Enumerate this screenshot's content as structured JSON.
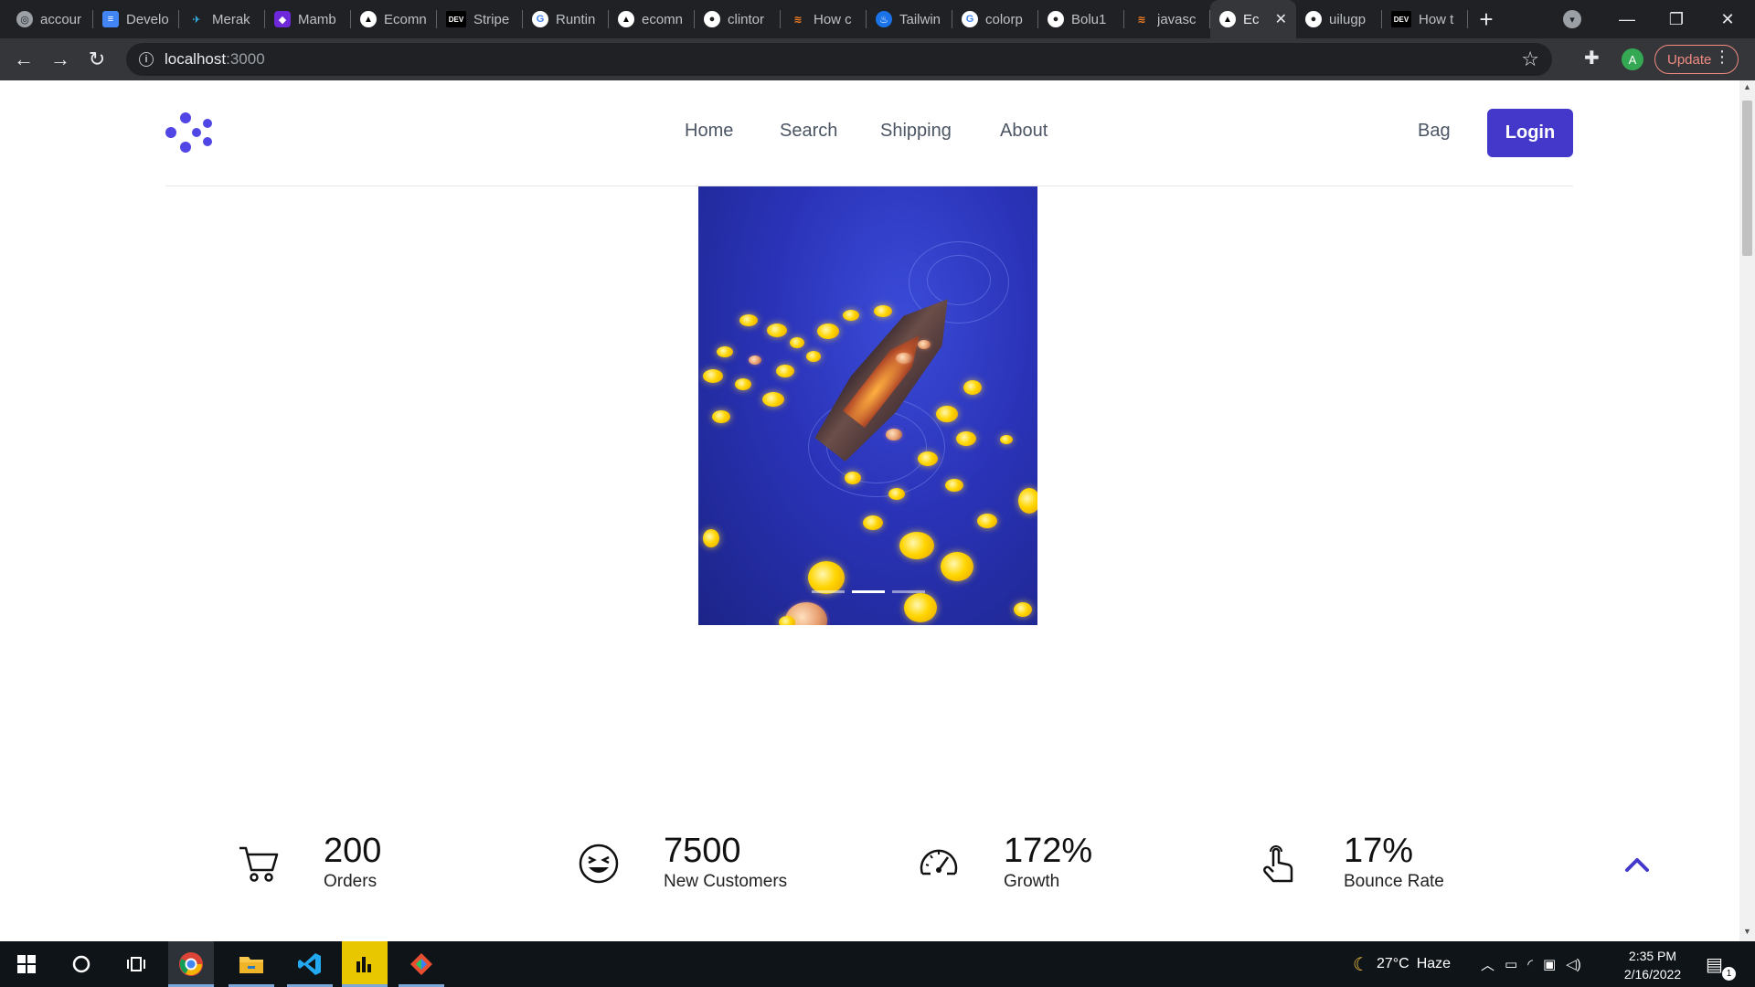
{
  "browser": {
    "tabs": [
      {
        "favicon": "globe-icon",
        "glyph": "◎",
        "title": "accour"
      },
      {
        "favicon": "docs-icon",
        "glyph": "≡",
        "title": "Develo"
      },
      {
        "favicon": "bird-icon",
        "glyph": "✈",
        "title": "Merak"
      },
      {
        "favicon": "mamba-icon",
        "glyph": "◆",
        "title": "Mamb"
      },
      {
        "favicon": "vercel-icon",
        "glyph": "▲",
        "title": "Ecomn"
      },
      {
        "favicon": "dev-icon",
        "glyph": "DEV",
        "title": "Stripe"
      },
      {
        "favicon": "google-icon",
        "glyph": "G",
        "title": "Runtin"
      },
      {
        "favicon": "vercel-icon",
        "glyph": "▲",
        "title": "ecomn"
      },
      {
        "favicon": "github-icon",
        "glyph": "●",
        "title": "clintor"
      },
      {
        "favicon": "stackoverflow-icon",
        "glyph": "≋",
        "title": "How c"
      },
      {
        "favicon": "tailwind-icon",
        "glyph": "♨",
        "title": "Tailwin"
      },
      {
        "favicon": "google-icon",
        "glyph": "G",
        "title": "colorp"
      },
      {
        "favicon": "github-icon",
        "glyph": "●",
        "title": "Bolu1"
      },
      {
        "favicon": "stackoverflow-icon",
        "glyph": "≋",
        "title": "javasc"
      },
      {
        "favicon": "vercel-icon",
        "glyph": "▲",
        "title": "Ec",
        "active": true
      },
      {
        "favicon": "github-icon",
        "glyph": "●",
        "title": "uilugp"
      },
      {
        "favicon": "dev-icon",
        "glyph": "DEV",
        "title": "How t"
      }
    ],
    "new_tab": "+",
    "url_host": "localhost",
    "url_port": ":3000",
    "avatar_initial": "A",
    "update_label": "Update",
    "window_controls": {
      "minimize": "—",
      "maximize": "❐",
      "close": "✕"
    }
  },
  "site": {
    "nav": {
      "links": [
        "Home",
        "Search",
        "Shipping",
        "About"
      ],
      "bag": "Bag",
      "login": "Login"
    },
    "carousel": {
      "slides": 3,
      "active_slide": 2
    },
    "stats": [
      {
        "icon": "cart-icon",
        "value": "200",
        "label": "Orders"
      },
      {
        "icon": "smiley-icon",
        "value": "7500",
        "label": "New Customers"
      },
      {
        "icon": "speedometer-icon",
        "value": "172%",
        "label": "Growth"
      },
      {
        "icon": "pointer-hand-icon",
        "value": "17%",
        "label": "Bounce Rate"
      }
    ],
    "accent_color": "#4338ca"
  },
  "taskbar": {
    "weather_temp": "27°C",
    "weather_desc": "Haze",
    "time": "2:35 PM",
    "date": "2/16/2022",
    "notification_count": "1"
  }
}
